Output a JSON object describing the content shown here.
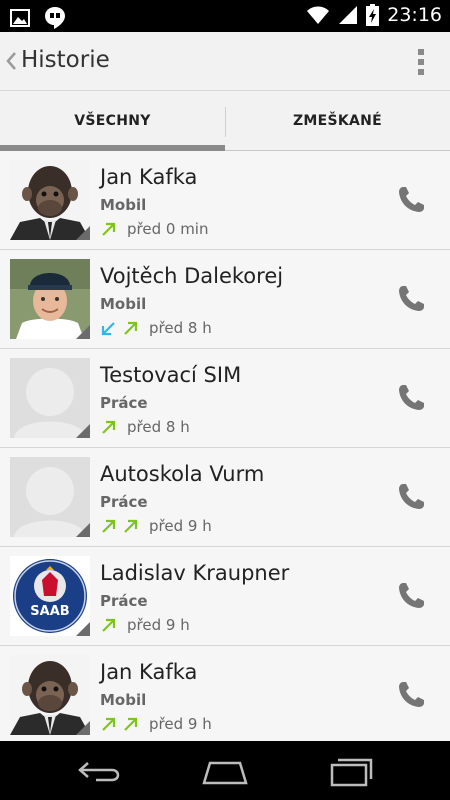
{
  "status_bar": {
    "time": "23:16",
    "left_icons": [
      "image-icon",
      "hangouts-icon"
    ],
    "right_icons": [
      "wifi-icon",
      "signal-icon",
      "battery-charging-icon"
    ]
  },
  "action_bar": {
    "title": "Historie"
  },
  "tabs": [
    {
      "label": "VŠECHNY",
      "selected": true
    },
    {
      "label": "ZMEŠKANÉ",
      "selected": false
    }
  ],
  "colors": {
    "outgoing_arrow": "#7fc41b",
    "incoming_arrow": "#33b5e5",
    "indicator": "#8a8a8a"
  },
  "calls": [
    {
      "name": "Jan Kafka",
      "type": "Mobil",
      "time": "před 0 min",
      "directions": [
        "outgoing"
      ],
      "avatar": "chimp-in-suit-photo"
    },
    {
      "name": "Vojtěch Dalekorej",
      "type": "Mobil",
      "time": "před 8 h",
      "directions": [
        "incoming",
        "outgoing"
      ],
      "avatar": "man-with-cap-photo"
    },
    {
      "name": "Testovací SIM",
      "type": "Práce",
      "time": "před 8 h",
      "directions": [
        "outgoing"
      ],
      "avatar": "default-contact-placeholder"
    },
    {
      "name": "Autoskola Vurm",
      "type": "Práce",
      "time": "před 9 h",
      "directions": [
        "outgoing",
        "outgoing"
      ],
      "avatar": "default-contact-placeholder"
    },
    {
      "name": "Ladislav Kraupner",
      "type": "Práce",
      "time": "před 9 h",
      "directions": [
        "outgoing"
      ],
      "avatar": "saab-logo"
    },
    {
      "name": "Jan Kafka",
      "type": "Mobil",
      "time": "před 9 h",
      "directions": [
        "outgoing",
        "outgoing"
      ],
      "avatar": "chimp-in-suit-photo"
    }
  ],
  "nav_bar": {
    "buttons": [
      "back-icon",
      "home-icon",
      "recents-icon"
    ]
  }
}
